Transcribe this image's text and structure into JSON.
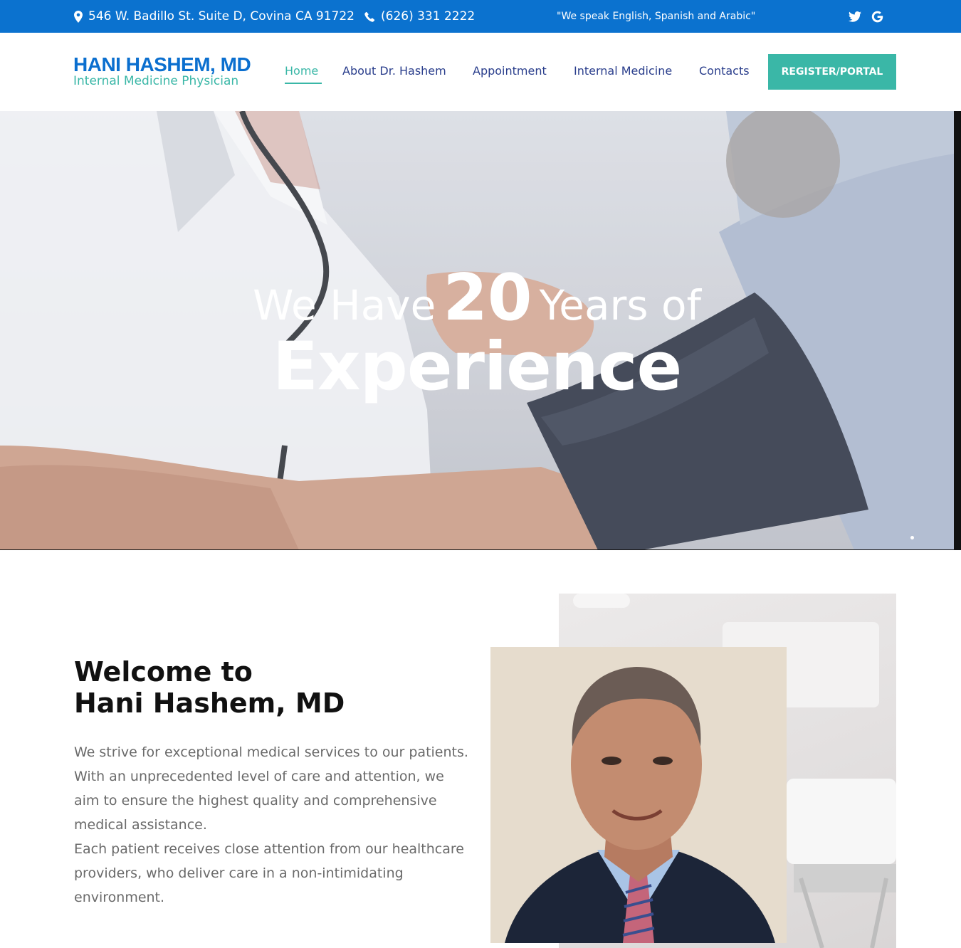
{
  "topbar": {
    "address": "546 W. Badillo St. Suite D, Covina CA 91722",
    "phone": "(626) 331 2222",
    "languages": "\"We speak English, Spanish and Arabic\"",
    "social": [
      "twitter-icon",
      "google-icon"
    ]
  },
  "header": {
    "logo_name": "HANI HASHEM, MD",
    "logo_subtitle": "Internal Medicine Physician",
    "nav": [
      "Home",
      "About Dr. Hashem",
      "Appointment",
      "Internal Medicine",
      "Contacts"
    ],
    "active_nav": "Home",
    "register_label": "REGISTER/PORTAL"
  },
  "hero": {
    "line1_prefix": "We Have",
    "line1_number": "20",
    "line1_suffix": "Years of",
    "line2": "Experience"
  },
  "welcome": {
    "title_line1": "Welcome to",
    "title_line2": "Hani Hashem, MD",
    "paragraphs": [
      "We strive for exceptional medical services to our patients.",
      "With an unprecedented level of care and attention, we aim to ensure the highest quality and comprehensive medical assistance.",
      "Each patient receives close attention from our healthcare providers, who deliver care in a non-intimidating environment."
    ]
  },
  "colors": {
    "topbar_bg": "#0b72cf",
    "brand_blue": "#0b6fcf",
    "accent_teal": "#3ab7a7",
    "nav_text": "#2a3e8c"
  }
}
